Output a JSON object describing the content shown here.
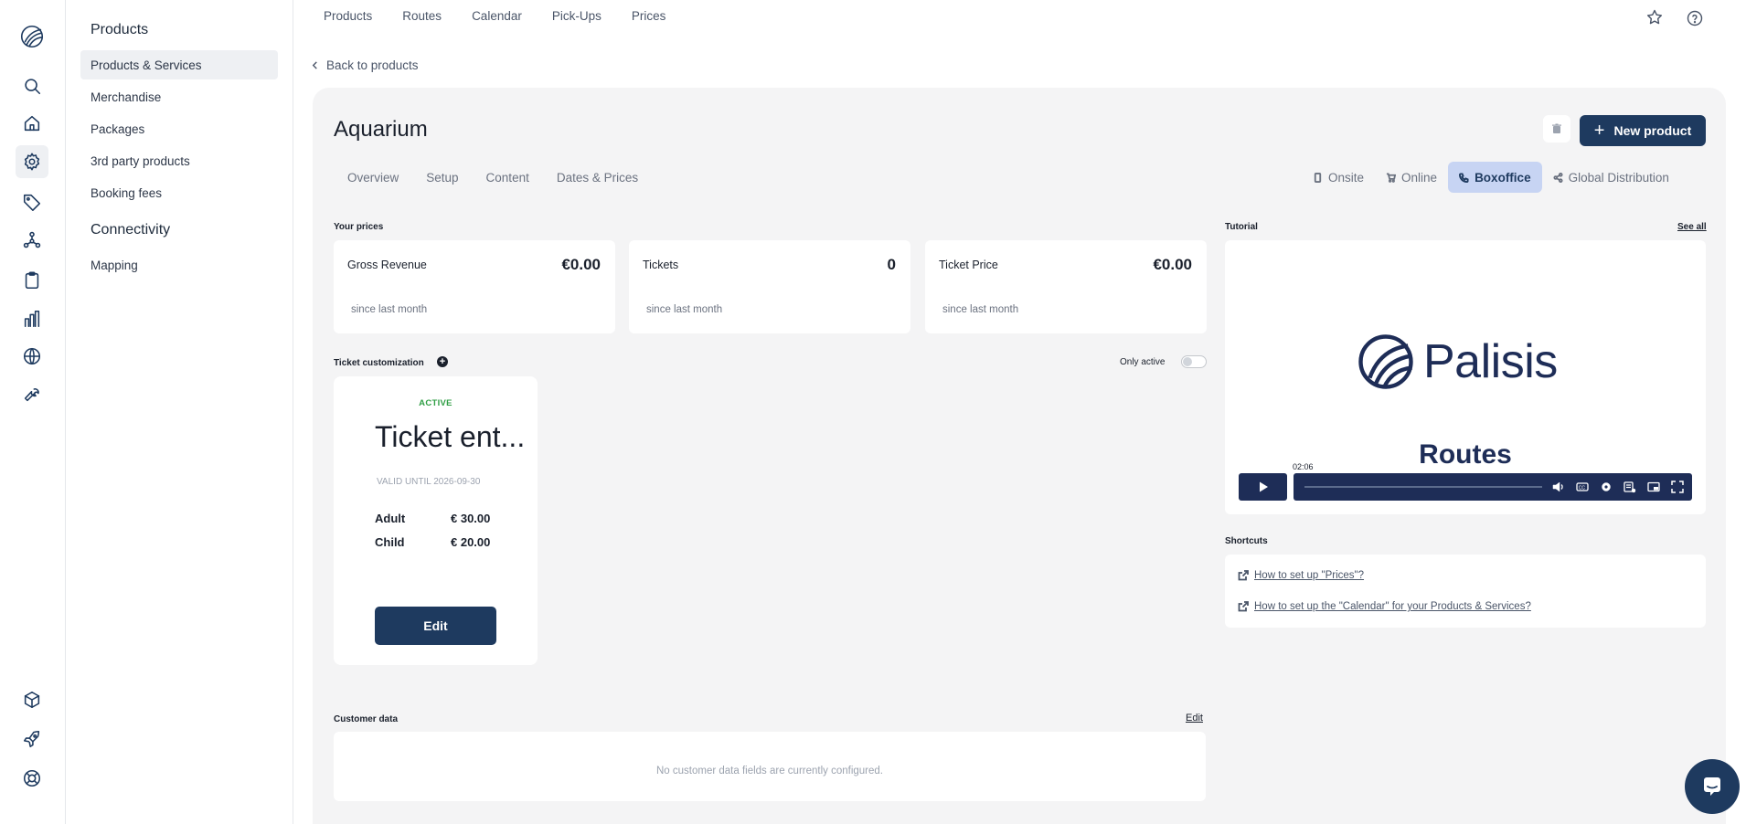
{
  "rail": {
    "top": [
      "logo-icon",
      "search-icon",
      "home-icon",
      "gear-icon",
      "tag-icon",
      "network-icon",
      "clipboard-icon",
      "bar-chart-icon",
      "globe-icon",
      "wrench-icon"
    ],
    "bottom": [
      "cube-icon",
      "rocket-icon",
      "lifebuoy-icon"
    ],
    "active": "gear-icon"
  },
  "subnav": {
    "section1": "Products",
    "items1": [
      "Products & Services",
      "Merchandise",
      "Packages",
      "3rd party products",
      "Booking fees"
    ],
    "section2": "Connectivity",
    "items2": [
      "Mapping"
    ]
  },
  "topnav": [
    "Products",
    "Routes",
    "Calendar",
    "Pick-Ups",
    "Prices"
  ],
  "back_label": "Back to products",
  "page": {
    "title": "Aquarium",
    "new_product_label": "New product",
    "tabs": [
      "Overview",
      "Setup",
      "Content",
      "Dates & Prices"
    ],
    "channels": [
      "Onsite",
      "Online",
      "Boxoffice",
      "Global Distribution"
    ],
    "selected_channel": "Boxoffice"
  },
  "prices": {
    "label": "Your prices",
    "stats": [
      {
        "name": "Gross Revenue",
        "value": "€0.00",
        "sub": "since last month"
      },
      {
        "name": "Tickets",
        "value": "0",
        "sub": "since last month"
      },
      {
        "name": "Ticket Price",
        "value": "€0.00",
        "sub": "since last month"
      }
    ]
  },
  "ticket_customization": {
    "label": "Ticket customization",
    "only_active_label": "Only active",
    "ticket": {
      "status": "ACTIVE",
      "name": "Ticket ent...",
      "valid": "VALID UNTIL 2026-09-30",
      "prices": [
        {
          "label": "Adult",
          "amount": "€ 30.00"
        },
        {
          "label": "Child",
          "amount": "€ 20.00"
        }
      ],
      "edit_label": "Edit"
    }
  },
  "customer_data": {
    "label": "Customer data",
    "edit_label": "Edit",
    "empty": "No customer data fields are currently configured."
  },
  "tutorial": {
    "label": "Tutorial",
    "see_all": "See all",
    "brand": "Palisis",
    "video_title": "Routes",
    "time": "02:06"
  },
  "shortcuts": {
    "label": "Shortcuts",
    "links": [
      "How to set up \"Prices\"?",
      "How to set up the \"Calendar\" for your Products & Services?"
    ]
  },
  "colors": {
    "primary": "#1e3a5f",
    "selected_channel_bg": "#c7d4f3",
    "active_status": "#2f9e44",
    "panel_bg": "#f4f4f5"
  }
}
